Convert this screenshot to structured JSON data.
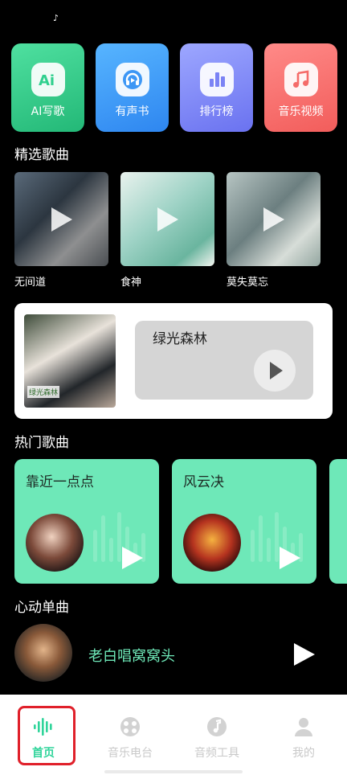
{
  "status": {
    "icon": "tiktok-icon"
  },
  "features": [
    {
      "label": "AI写歌",
      "icon": "ai-icon",
      "color": "#2fd08e"
    },
    {
      "label": "有声书",
      "icon": "headphones-icon",
      "color": "#3d97f5"
    },
    {
      "label": "排行榜",
      "icon": "bar-chart-icon",
      "color": "#7b83f5"
    },
    {
      "label": "音乐视频",
      "icon": "music-note-icon",
      "color": "#f56b69"
    }
  ],
  "sections": {
    "selected": "精选歌曲",
    "hot": "热门歌曲",
    "heart": "心动单曲"
  },
  "selected_songs": [
    {
      "name": "无间道"
    },
    {
      "name": "食神"
    },
    {
      "name": "莫失莫忘"
    }
  ],
  "featured": {
    "title": "绿光森林",
    "poster_title": "绿光森林"
  },
  "hot_songs": [
    {
      "title": "靠近一点点"
    },
    {
      "title": "风云决"
    }
  ],
  "single": {
    "name": "老白唱窝窝头"
  },
  "tabbar": {
    "items": [
      {
        "label": "首页",
        "icon": "sound-wave-icon",
        "active": true
      },
      {
        "label": "音乐电台",
        "icon": "radio-icon",
        "active": false
      },
      {
        "label": "音频工具",
        "icon": "note-tool-icon",
        "active": false
      },
      {
        "label": "我的",
        "icon": "user-icon",
        "active": false
      }
    ],
    "active_color": "#2fd49a"
  }
}
